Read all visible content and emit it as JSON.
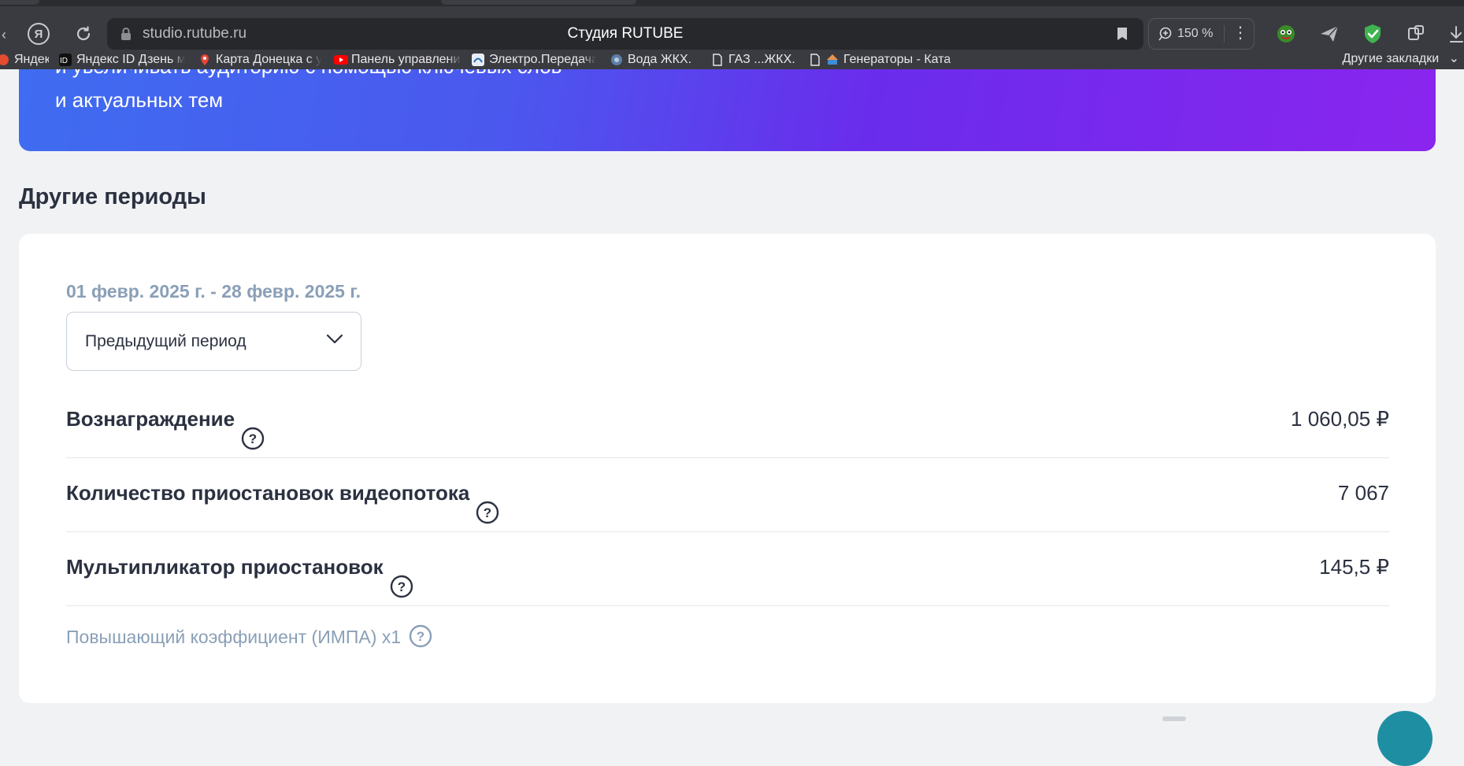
{
  "browser": {
    "url": "studio.rutube.ru",
    "tab_title": "Студия RUTUBE",
    "zoom": "150 %",
    "bookmarks": [
      {
        "label": "Яндекс",
        "icon": "yandex-icon"
      },
      {
        "label": "Яндекс ID Дзень м",
        "icon": "yandex-id-icon"
      },
      {
        "label": "Карта Донецка с у",
        "icon": "map-pin-icon"
      },
      {
        "label": "Панель управлени",
        "icon": "youtube-icon"
      },
      {
        "label": "Электро.Передача",
        "icon": "electro-icon"
      },
      {
        "label": "Вода ЖКХ.",
        "icon": "water-icon"
      },
      {
        "label": "ГАЗ ...ЖКХ.",
        "icon": "document-icon"
      },
      {
        "label": "Генераторы - Ката",
        "icon": "generator-icon"
      }
    ],
    "other_bookmarks": "Другие закладки"
  },
  "banner": {
    "line1": "и увеличивать аудиторию с помощью ключевых слов",
    "line2": "и актуальных тем"
  },
  "section": {
    "title": "Другие периоды"
  },
  "period": {
    "date_range": "01 февр. 2025 г. - 28 февр. 2025 г.",
    "selected": "Предыдущий период"
  },
  "metrics": [
    {
      "label": "Вознаграждение",
      "value": "1 060,05 ₽"
    },
    {
      "label": "Количество приостановок видеопотока",
      "value": "7 067"
    },
    {
      "label": "Мультипликатор приостановок",
      "value": "145,5 ₽"
    }
  ],
  "boost": {
    "label": "Повышающий коэффициент (ИМПА) x1"
  },
  "colors": {
    "page_bg": "#f1f2f4",
    "card_bg": "#ffffff",
    "muted_text": "#8a9fb7",
    "banner_start": "#3f6cf0",
    "banner_end": "#8a25ee"
  }
}
